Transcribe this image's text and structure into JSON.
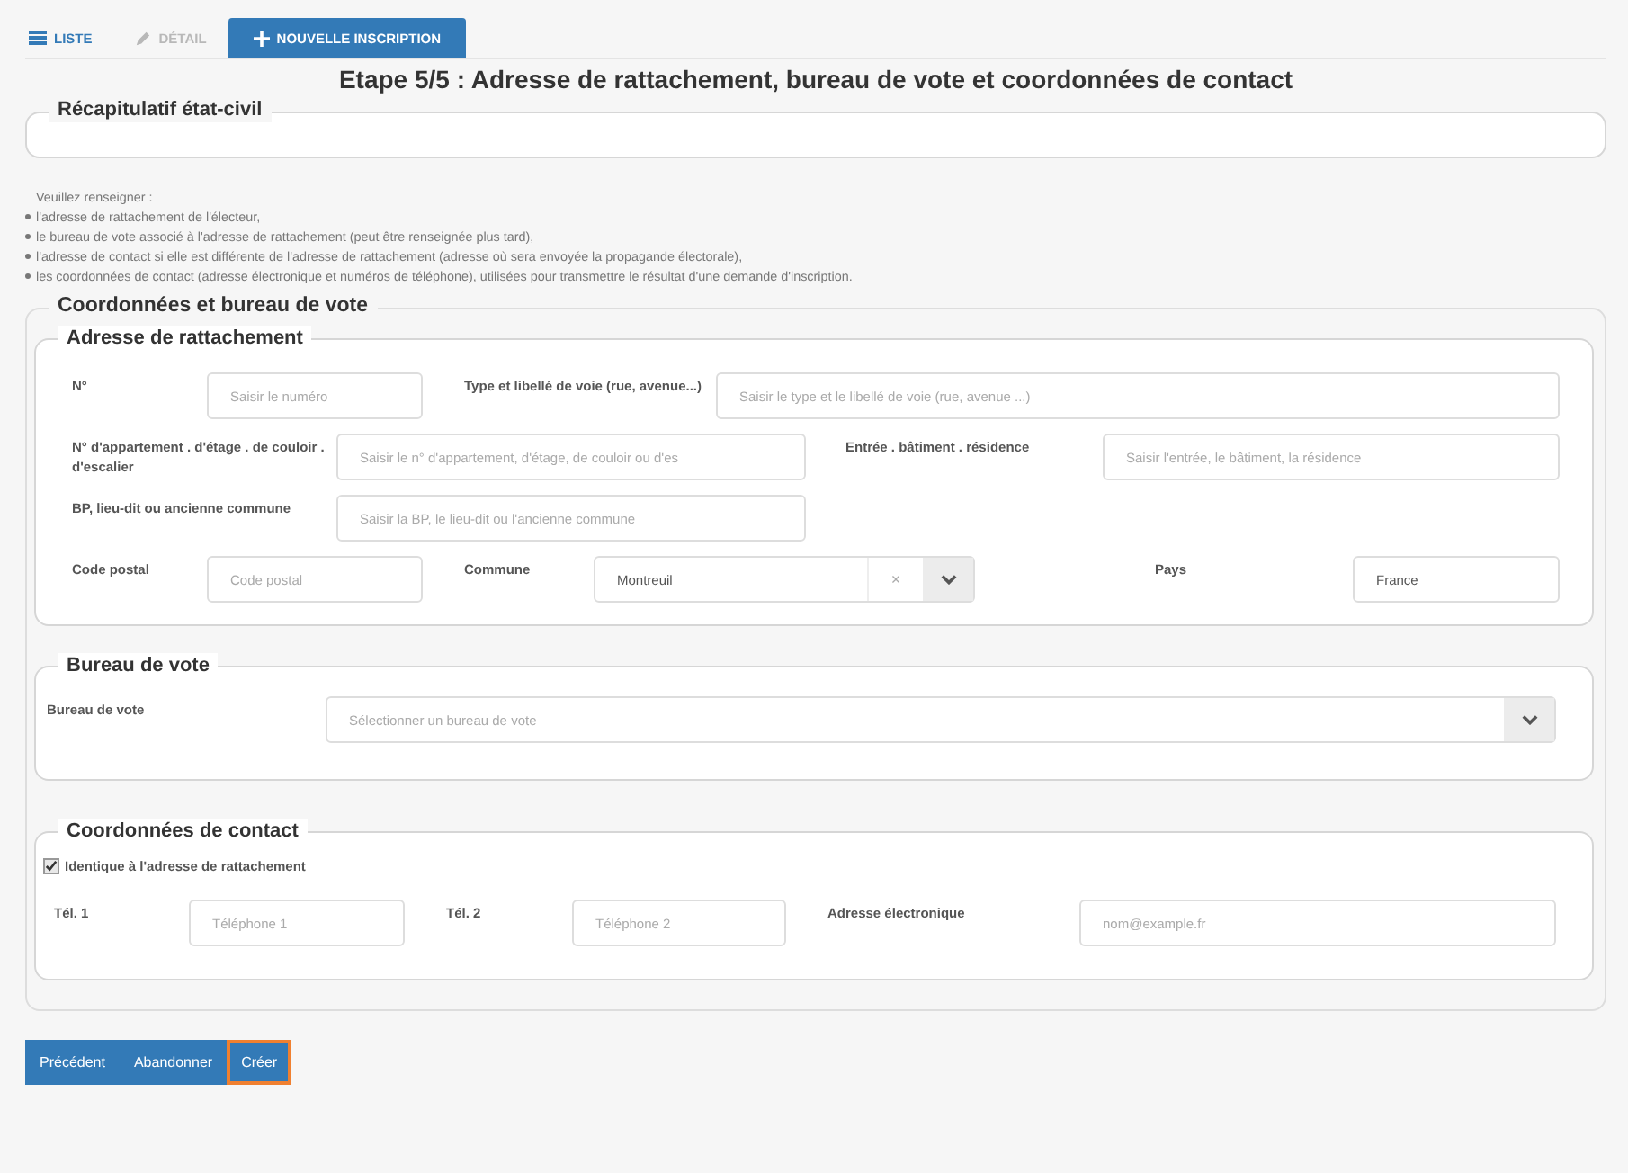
{
  "tabs": [
    {
      "label": "LISTE",
      "kind": "list",
      "selected": false,
      "disabled": false
    },
    {
      "label": "DÉTAIL",
      "kind": "edit",
      "selected": false,
      "disabled": true
    },
    {
      "label": "NOUVELLE INSCRIPTION",
      "kind": "new",
      "selected": true,
      "disabled": false
    }
  ],
  "title": "Etape 5/5 : Adresse de rattachement, bureau de vote et coordonnées de contact",
  "recap": {
    "legend": "Récapitulatif état-civil"
  },
  "instructions": {
    "intro": "Veuillez renseigner :",
    "items": [
      "l'adresse de rattachement de l'électeur,",
      "le bureau de vote associé à l'adresse de rattachement (peut être renseignée plus tard),",
      "l'adresse de contact si elle est différente de l'adresse de rattachement (adresse où sera envoyée la propagande électorale),",
      "les coordonnées de contact (adresse électronique et numéros de téléphone), utilisées pour transmettre le résultat d'une demande d'inscription."
    ]
  },
  "section": {
    "legend": "Coordonnées et bureau de vote",
    "address": {
      "legend": "Adresse de rattachement",
      "rows": [
        [
          {
            "label": "N°",
            "kind": "text",
            "placeholder": "Saisir le numéro"
          },
          {
            "label": "Type et libellé de voie (rue, avenue...)",
            "kind": "text",
            "placeholder": "Saisir le type et le libellé de voie (rue, avenue ...)"
          }
        ],
        [
          {
            "label": "N° d'appartement . d'étage . de couloir . d'escalier",
            "kind": "text",
            "placeholder": "Saisir le n° d'appartement, d'étage, de couloir ou d'es"
          },
          {
            "label": "Entrée . bâtiment . résidence",
            "kind": "text",
            "placeholder": "Saisir l'entrée, le bâtiment, la résidence"
          }
        ],
        [
          {
            "label": "BP, lieu-dit ou ancienne commune",
            "kind": "text",
            "placeholder": "Saisir la BP, le lieu-dit ou l'ancienne commune"
          }
        ],
        [
          {
            "label": "Code postal",
            "kind": "text",
            "placeholder": "Code postal"
          },
          {
            "label": "Commune",
            "kind": "select",
            "value": "Montreuil",
            "clear": "×"
          },
          {
            "label": "Pays",
            "kind": "text",
            "value": "France"
          }
        ]
      ]
    },
    "bureau": {
      "legend": "Bureau de vote",
      "label": "Bureau de vote",
      "placeholder": "Sélectionner un bureau de vote"
    },
    "contact": {
      "legend": "Coordonnées de contact",
      "same_label": "Identique à l'adresse de rattachement",
      "checked": true,
      "fields": [
        {
          "label": "Tél. 1",
          "placeholder": "Téléphone 1"
        },
        {
          "label": "Tél. 2",
          "placeholder": "Téléphone 2"
        },
        {
          "label": "Adresse électronique",
          "placeholder": "nom@example.fr"
        }
      ]
    }
  },
  "buttons": [
    {
      "label": "Précédent",
      "focused": false
    },
    {
      "label": "Abandonner",
      "focused": false
    },
    {
      "label": "Créer",
      "focused": true
    }
  ]
}
